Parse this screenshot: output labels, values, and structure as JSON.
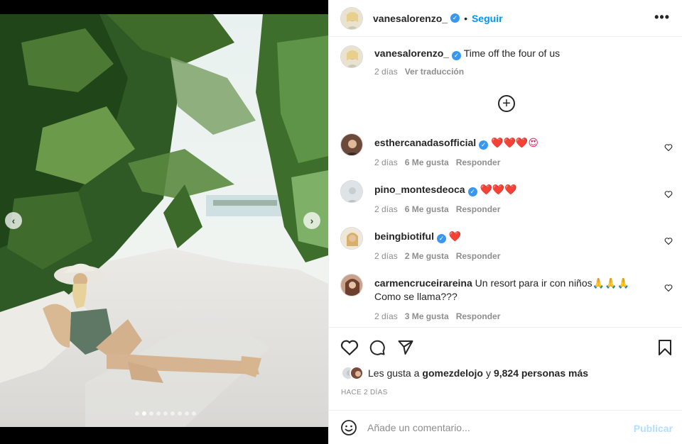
{
  "post": {
    "author": "vanesalorenzo_",
    "follow_label": "Seguir",
    "more_label": "•••",
    "caption_text": "Time off the four of us",
    "caption_age": "2 días",
    "translate_label": "Ver traducción"
  },
  "media": {
    "prev_label": "‹",
    "next_label": "›",
    "slide_count": 9,
    "active_slide": 2
  },
  "comments": [
    {
      "user": "esthercanadasofficial",
      "text": "❤️❤️❤️😍",
      "age": "2 días",
      "likes": "6 Me gusta",
      "reply": "Responder"
    },
    {
      "user": "pino_montesdeoca",
      "text": "❤️❤️❤️",
      "age": "2 días",
      "likes": "6 Me gusta",
      "reply": "Responder"
    },
    {
      "user": "beingbiotiful",
      "text": "❤️",
      "age": "2 días",
      "likes": "2 Me gusta",
      "reply": "Responder"
    },
    {
      "user": "carmencruceirareina",
      "text": "Un resort para ir con niños🙏🙏🙏 Como se llama???",
      "age": "2 días",
      "likes": "3 Me gusta",
      "reply": "Responder"
    }
  ],
  "likes_line": {
    "prefix": "Les gusta a",
    "user": "gomezdelojo",
    "joiner": "y",
    "others": "9,824 personas más"
  },
  "timestamp": "HACE 2 DÍAS",
  "add_comment": {
    "placeholder": "Añade un comentario...",
    "publish_label": "Publicar"
  },
  "colors": {
    "accent": "#0095f6",
    "verified": "#3897f0",
    "publish_disabled": "#b2dffc",
    "muted": "#8e8e8e"
  }
}
